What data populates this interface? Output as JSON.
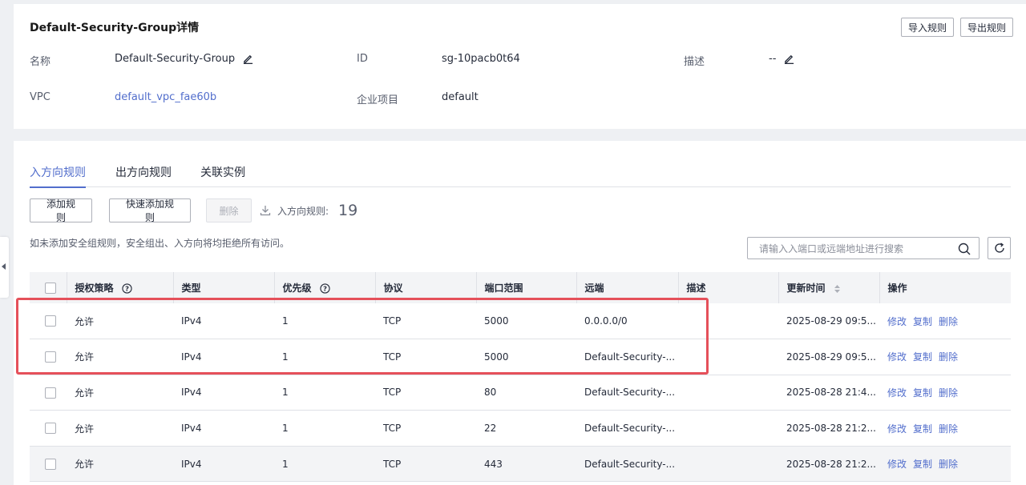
{
  "header": {
    "title": "Default-Security-Group详情",
    "import_label": "导入规则",
    "export_label": "导出规则"
  },
  "details": {
    "name_label": "名称",
    "name_value": "Default-Security-Group",
    "id_label": "ID",
    "id_value": "sg-10pacb0t64",
    "desc_label": "描述",
    "desc_value": "--",
    "vpc_label": "VPC",
    "vpc_value": "default_vpc_fae60b",
    "project_label": "企业项目",
    "project_value": "default"
  },
  "tabs": [
    {
      "label": "入方向规则"
    },
    {
      "label": "出方向规则"
    },
    {
      "label": "关联实例"
    }
  ],
  "toolbar": {
    "add_label": "添加规则",
    "quick_add_label": "快速添加规则",
    "delete_label": "删除",
    "count_label": "入方向规则:",
    "count_value": "19"
  },
  "hint": "如未添加安全组规则，安全组出、入方向将均拒绝所有访问。",
  "search": {
    "placeholder": "请输入入端口或远端地址进行搜索"
  },
  "table": {
    "headers": [
      "授权策略",
      "类型",
      "优先级",
      "协议",
      "端口范围",
      "远端",
      "描述",
      "更新时间",
      "操作"
    ],
    "rows": [
      {
        "policy": "允许",
        "type": "IPv4",
        "priority": "1",
        "protocol": "TCP",
        "port": "5000",
        "remote": "0.0.0.0/0",
        "desc": "",
        "updated": "2025-08-29 09:5..."
      },
      {
        "policy": "允许",
        "type": "IPv4",
        "priority": "1",
        "protocol": "TCP",
        "port": "5000",
        "remote": "Default-Security-...",
        "desc": "",
        "updated": "2025-08-29 09:5..."
      },
      {
        "policy": "允许",
        "type": "IPv4",
        "priority": "1",
        "protocol": "TCP",
        "port": "80",
        "remote": "Default-Security-...",
        "desc": "",
        "updated": "2025-08-28 21:4..."
      },
      {
        "policy": "允许",
        "type": "IPv4",
        "priority": "1",
        "protocol": "TCP",
        "port": "22",
        "remote": "Default-Security-...",
        "desc": "",
        "updated": "2025-08-28 21:2..."
      },
      {
        "policy": "允许",
        "type": "IPv4",
        "priority": "1",
        "protocol": "TCP",
        "port": "443",
        "remote": "Default-Security-...",
        "desc": "",
        "updated": "2025-08-28 21:2..."
      }
    ],
    "ops": {
      "modify": "修改",
      "copy": "复制",
      "delete": "删除"
    }
  },
  "colors": {
    "accent": "#526ecc",
    "highlight": "#e5505a"
  }
}
